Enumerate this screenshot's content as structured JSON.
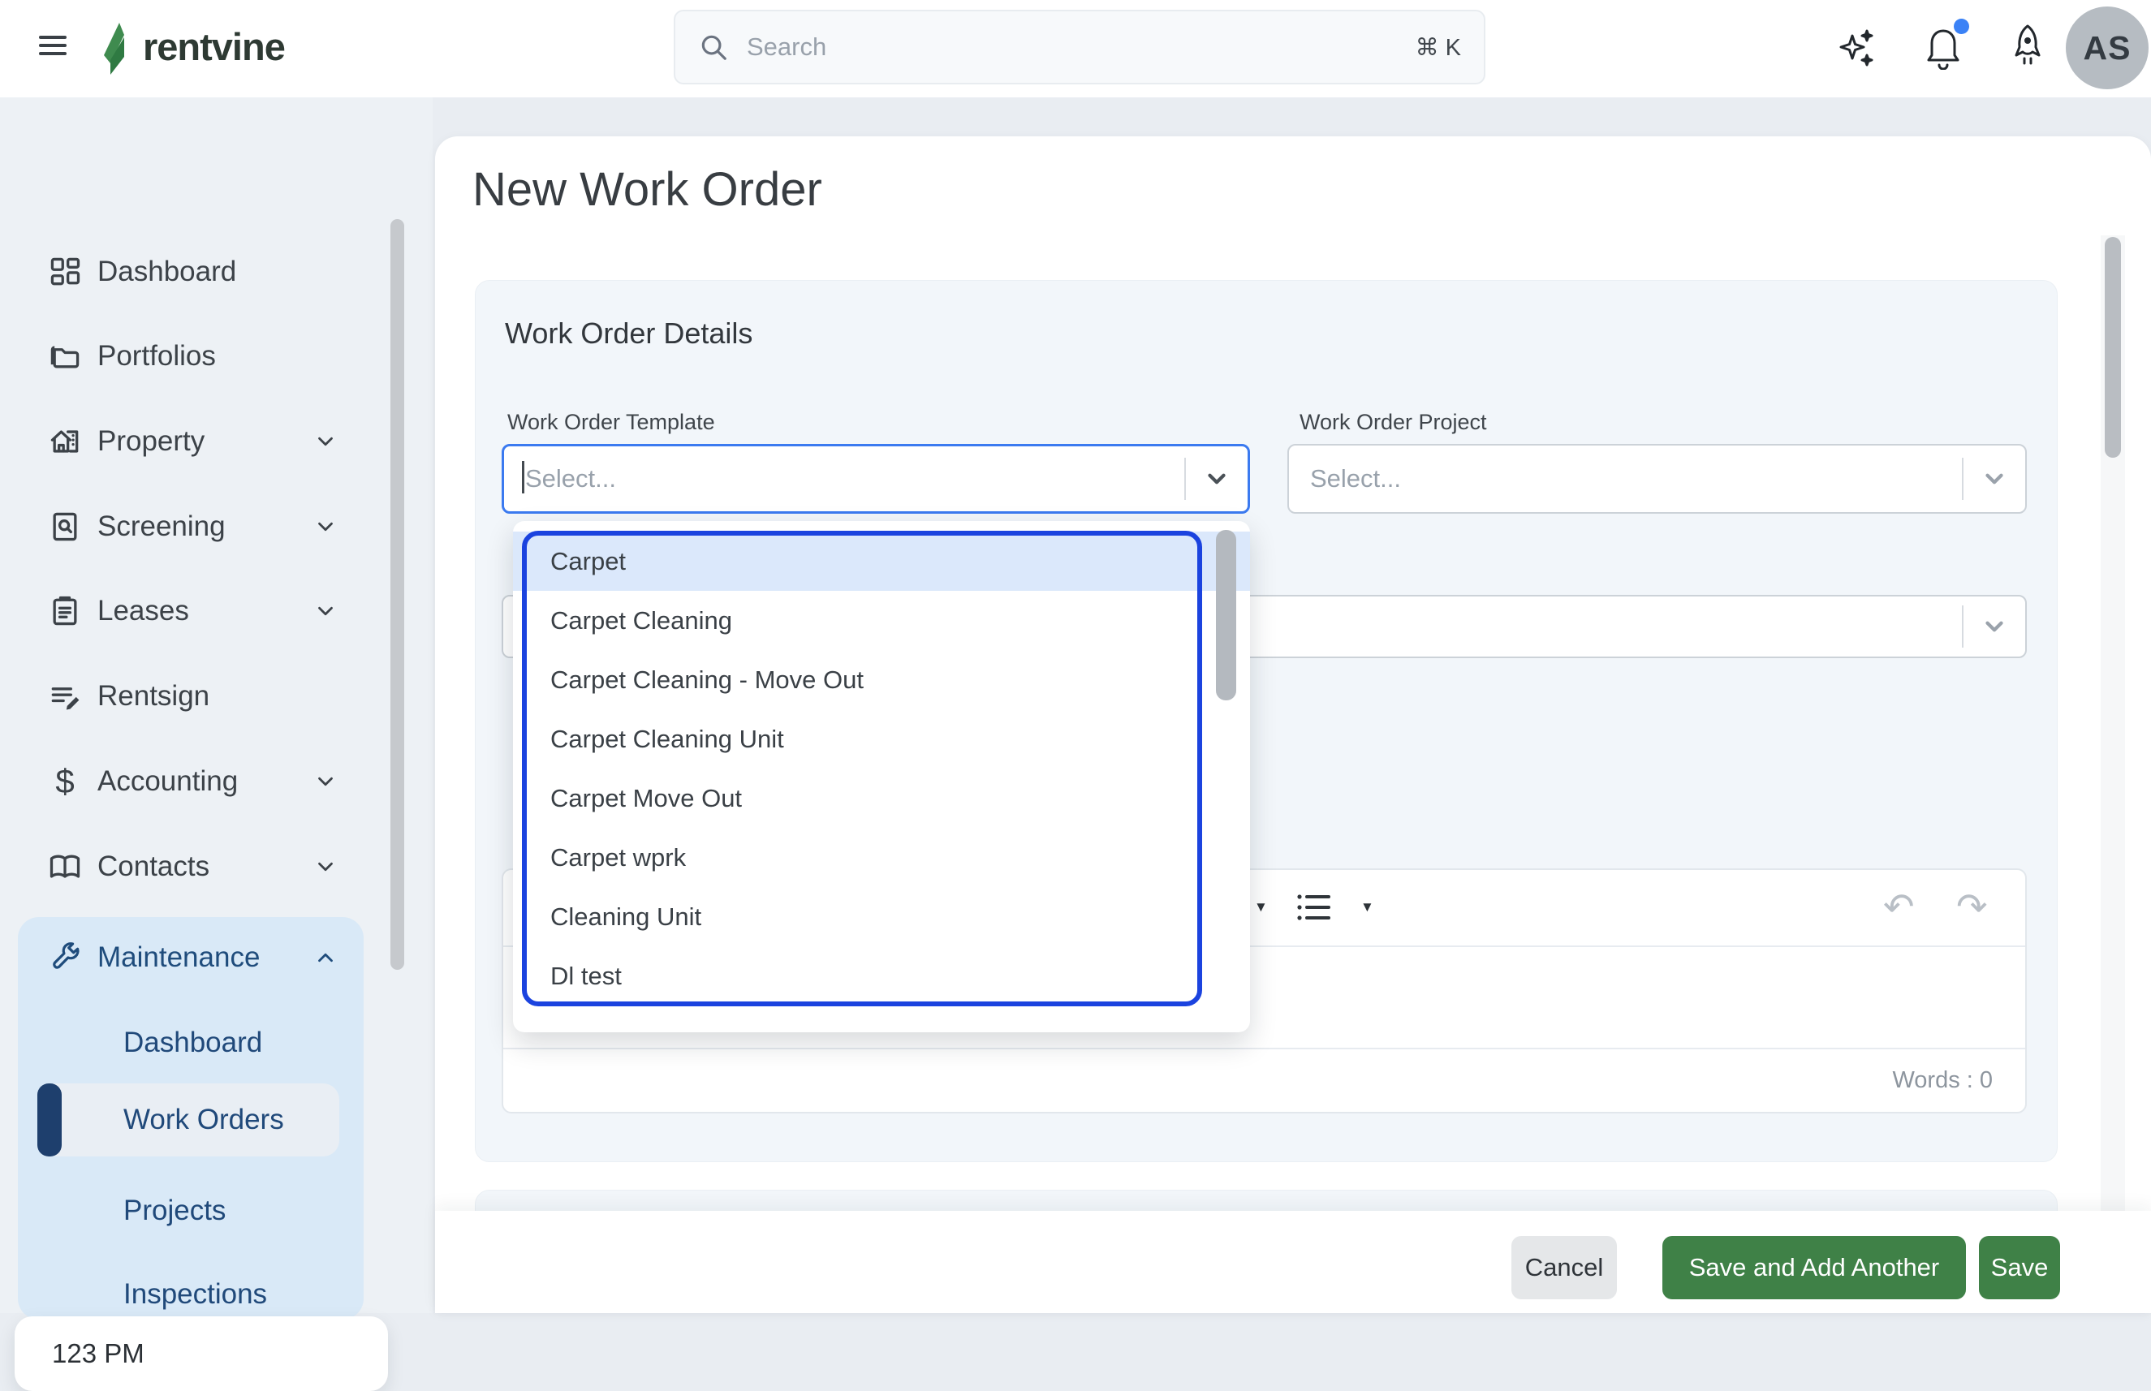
{
  "brand": {
    "name": "rentvine"
  },
  "header": {
    "search_placeholder": "Search",
    "search_shortcut": "⌘ K",
    "avatar_initials": "AS"
  },
  "sidebar": {
    "items": [
      {
        "label": "Dashboard",
        "chevron": false
      },
      {
        "label": "Portfolios",
        "chevron": false
      },
      {
        "label": "Property",
        "chevron": true
      },
      {
        "label": "Screening",
        "chevron": true
      },
      {
        "label": "Leases",
        "chevron": true
      },
      {
        "label": "Rentsign",
        "chevron": false
      },
      {
        "label": "Accounting",
        "chevron": true
      },
      {
        "label": "Contacts",
        "chevron": true
      }
    ],
    "maintenance": {
      "label": "Maintenance",
      "children": [
        {
          "label": "Dashboard",
          "selected": false
        },
        {
          "label": "Work Orders",
          "selected": true
        },
        {
          "label": "Projects",
          "selected": false
        },
        {
          "label": "Inspections",
          "selected": false
        }
      ]
    },
    "clock": "123 PM"
  },
  "main": {
    "title": "New Work Order",
    "section_title": "Work Order Details",
    "fields": {
      "template_label": "Work Order Template",
      "template_placeholder": "Select...",
      "project_label": "Work Order Project",
      "project_placeholder": "Select..."
    },
    "editor": {
      "words": "Words : 0"
    },
    "buttons": {
      "cancel": "Cancel",
      "save_add": "Save and Add Another",
      "save": "Save"
    }
  },
  "dropdown": {
    "highlighted_index": 0,
    "options": [
      "Carpet",
      "Carpet Cleaning",
      "Carpet Cleaning - Move Out",
      "Carpet Cleaning Unit",
      "Carpet Move Out",
      "Carpet wprk",
      "Cleaning Unit",
      "Dl test"
    ]
  },
  "colors": {
    "accent_green": "#3F8147",
    "focus_blue": "#3B7AF0",
    "listbox_ring_blue": "#1B43DF",
    "option_highlight": "#DCE8FB",
    "nav_navy": "#1F4C7C",
    "notification_dot": "#3B82F6"
  }
}
